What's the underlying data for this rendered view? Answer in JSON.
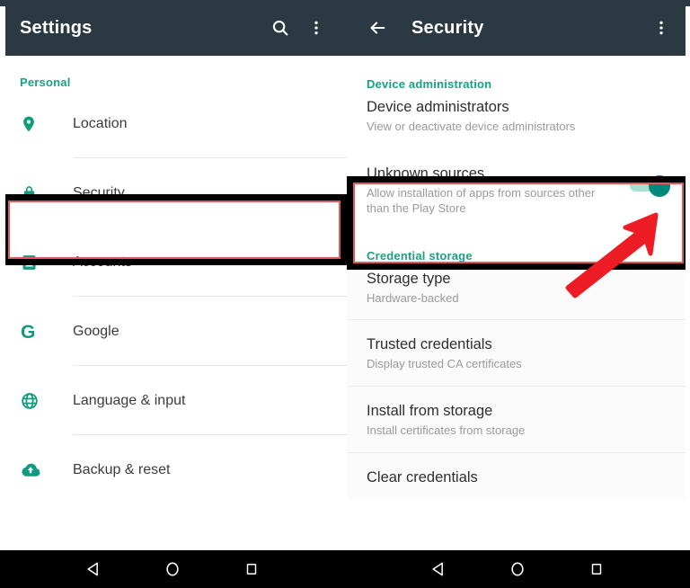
{
  "colors": {
    "appbar_bg": "#2b3942",
    "accent_teal": "#1aa083",
    "icon_teal": "#0f9b7e",
    "toggle_on": "#00897b",
    "toggle_track": "#a6ded0",
    "highlight_box": "#000000",
    "highlight_inner": "#e05a5a",
    "arrow": "#ee1c25",
    "navbar_bg": "#000000",
    "title_text": "#2e2e2e",
    "subtitle_text": "#9a9a9a"
  },
  "left_panel": {
    "appbar": {
      "title": "Settings",
      "search_icon": "search-icon",
      "overflow_icon": "more-vert-icon"
    },
    "section_header": "Personal",
    "items": [
      {
        "label": "Location",
        "icon": "location-pin-icon"
      },
      {
        "label": "Security",
        "icon": "lock-icon",
        "highlighted": true
      },
      {
        "label": "Accounts",
        "icon": "account-badge-icon"
      },
      {
        "label": "Google",
        "icon": "google-g-icon"
      },
      {
        "label": "Language & input",
        "icon": "globe-icon"
      },
      {
        "label": "Backup & reset",
        "icon": "cloud-upload-icon"
      }
    ]
  },
  "right_panel": {
    "appbar": {
      "back_icon": "arrow-back-icon",
      "title": "Security",
      "overflow_icon": "more-vert-icon"
    },
    "sections": [
      {
        "header": "Device administration",
        "rows": [
          {
            "title": "Device administrators",
            "subtitle": "View or deactivate device administrators",
            "toggle": null
          },
          {
            "title": "Unknown sources",
            "subtitle": "Allow installation of apps from sources other than the Play Store",
            "toggle": "on",
            "highlighted": true
          }
        ]
      },
      {
        "header": "Credential storage",
        "rows": [
          {
            "title": "Storage type",
            "subtitle": "Hardware-backed",
            "toggle": null
          },
          {
            "title": "Trusted credentials",
            "subtitle": "Display trusted CA certificates",
            "toggle": null
          },
          {
            "title": "Install from storage",
            "subtitle": "Install certificates from storage",
            "toggle": null
          },
          {
            "title": "Clear credentials",
            "subtitle": "",
            "toggle": null
          }
        ]
      }
    ]
  },
  "annotation": {
    "arrow_icon": "red-arrow-pointing-up-right",
    "arrow_target": "unknown-sources-toggle"
  },
  "navbar": {
    "buttons": [
      {
        "icon": "back-triangle-icon",
        "label": "Back"
      },
      {
        "icon": "home-circle-icon",
        "label": "Home"
      },
      {
        "icon": "recents-square-icon",
        "label": "Recents"
      }
    ]
  }
}
